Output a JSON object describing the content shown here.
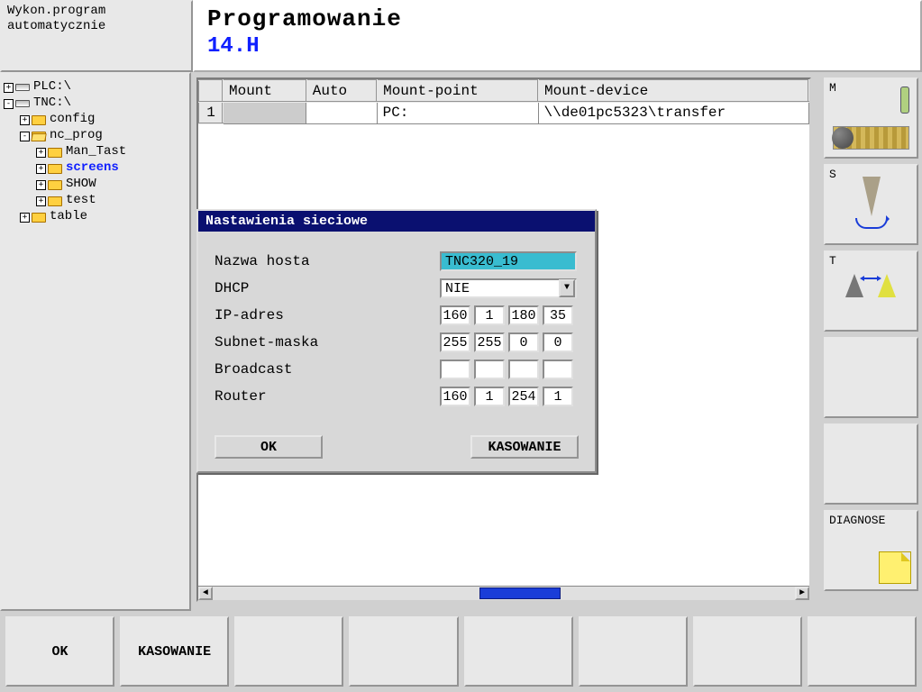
{
  "header": {
    "mode_line1": "Wykon.program",
    "mode_line2": "automatycznie",
    "title": "Programowanie",
    "file": "14.H"
  },
  "tree": {
    "root1": "PLC:\\",
    "root2": "TNC:\\",
    "config": "config",
    "ncprog": "nc_prog",
    "mantast": "Man_Tast",
    "screens": "screens",
    "show": "SHOW",
    "test": "test",
    "table": "table"
  },
  "table": {
    "headers": {
      "rownum": "",
      "mount": "Mount",
      "auto": "Auto",
      "mountpoint": "Mount-point",
      "mountdevice": "Mount-device"
    },
    "rows": [
      {
        "n": "1",
        "mount": "",
        "auto": "",
        "mountpoint": "PC:",
        "mountdevice": "\\\\de01pc5323\\transfer"
      }
    ]
  },
  "rightkeys": {
    "m": "M",
    "s": "S",
    "t": "T",
    "diag": "DIAGNOSE"
  },
  "dialog": {
    "title": "Nastawienia sieciowe",
    "hostname_label": "Nazwa hosta",
    "hostname": "TNC320_19",
    "dhcp_label": "DHCP",
    "dhcp_value": "NIE",
    "ip_label": "IP-adres",
    "ip": [
      "160",
      "1",
      "180",
      "35"
    ],
    "subnet_label": "Subnet-maska",
    "subnet": [
      "255",
      "255",
      "0",
      "0"
    ],
    "broadcast_label": "Broadcast",
    "broadcast": [
      "",
      "",
      "",
      ""
    ],
    "router_label": "Router",
    "router": [
      "160",
      "1",
      "254",
      "1"
    ],
    "ok": "OK",
    "cancel": "KASOWANIE"
  },
  "footer": {
    "ok": "OK",
    "cancel": "KASOWANIE",
    "b3": "",
    "b4": "",
    "b5": "",
    "b6": "",
    "b7": "",
    "b8": ""
  }
}
